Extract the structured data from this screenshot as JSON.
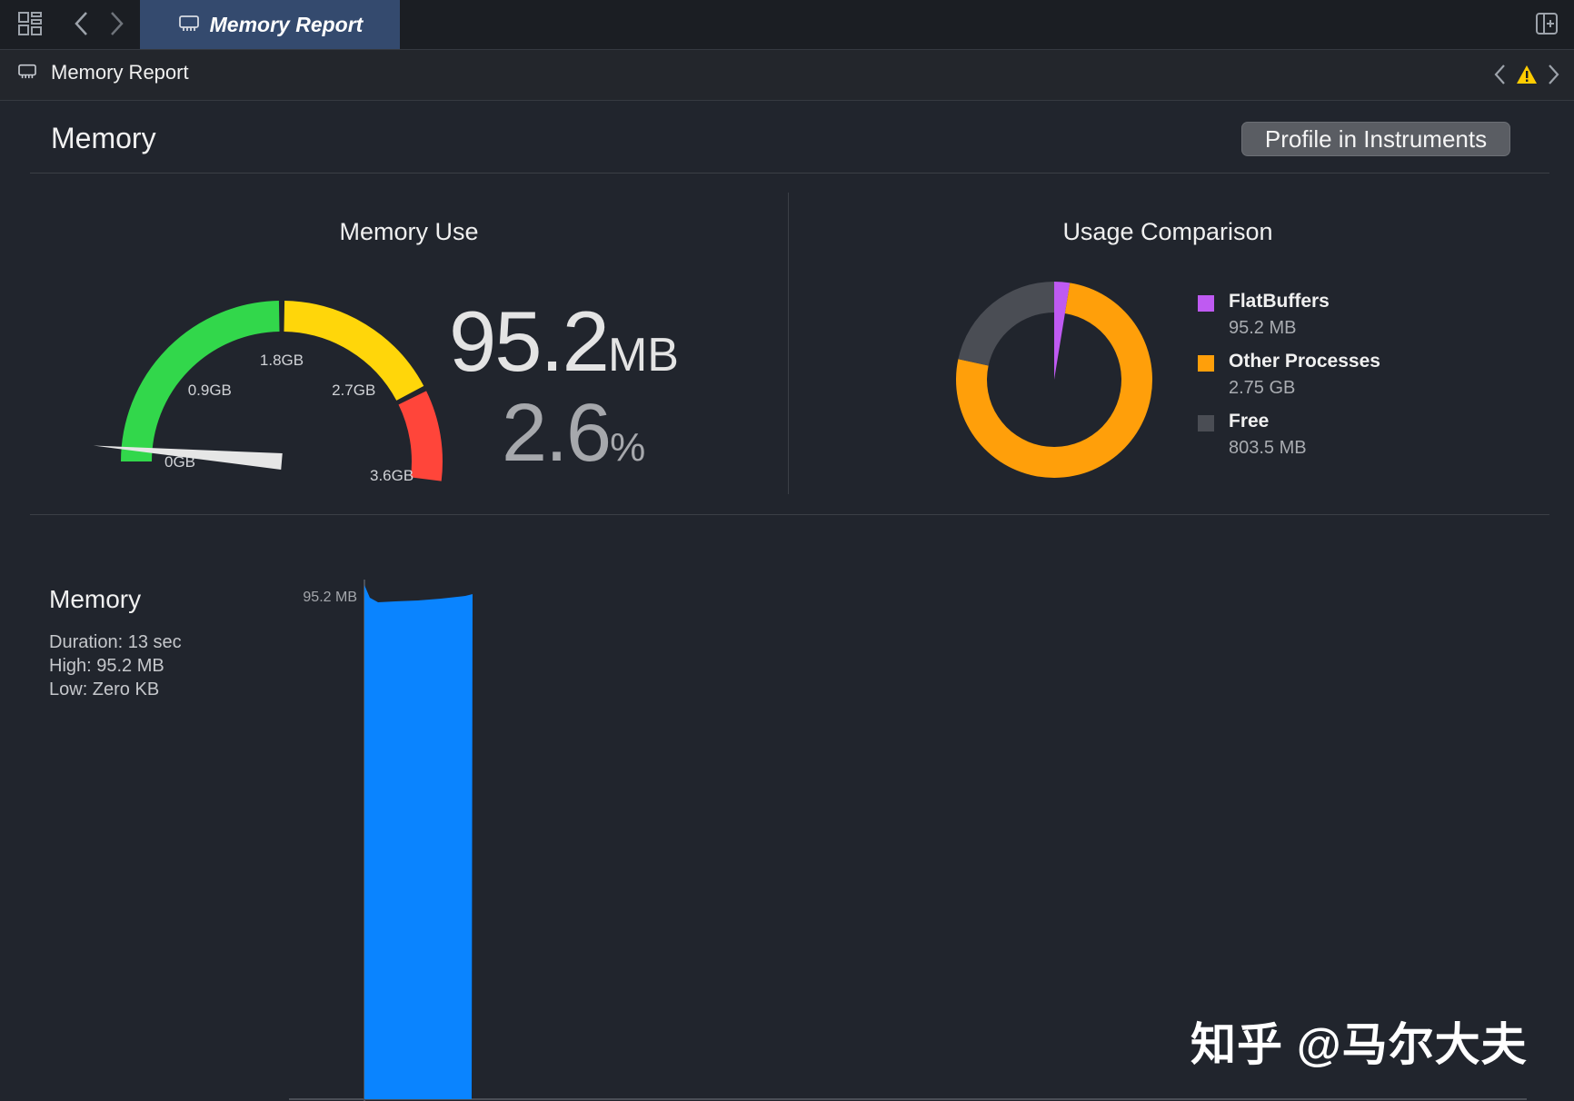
{
  "tabbar": {
    "active_tab_label": "Memory Report"
  },
  "breadcrumb": {
    "label": "Memory Report"
  },
  "header": {
    "title": "Memory",
    "profile_button": "Profile in Instruments"
  },
  "memory_use": {
    "title": "Memory Use",
    "value": "95.2",
    "unit": "MB",
    "percent": "2.6",
    "percent_unit": "%",
    "gauge_ticks": [
      "0GB",
      "0.9GB",
      "1.8GB",
      "2.7GB",
      "3.6GB"
    ],
    "gauge_colors": {
      "green": "#32d74b",
      "yellow": "#ffd60a",
      "red": "#ff453a"
    },
    "needle_value_gb": 0.093
  },
  "usage_comparison": {
    "title": "Usage Comparison",
    "items": [
      {
        "name": "FlatBuffers",
        "value": "95.2 MB",
        "color": "#bf5af2",
        "amount_mb": 95.2
      },
      {
        "name": "Other Processes",
        "value": "2.75 GB",
        "color": "#ff9f0a",
        "amount_mb": 2816
      },
      {
        "name": "Free",
        "value": "803.5 MB",
        "color": "#4a4d54",
        "amount_mb": 803.5
      }
    ]
  },
  "timeline": {
    "title": "Memory",
    "duration": "Duration: 13 sec",
    "high": "High: 95.2 MB",
    "low": "Low: Zero KB",
    "max_label": "95.2 MB",
    "bar_color": "#0a84ff"
  },
  "watermark": "知乎 @马尔大夫"
}
